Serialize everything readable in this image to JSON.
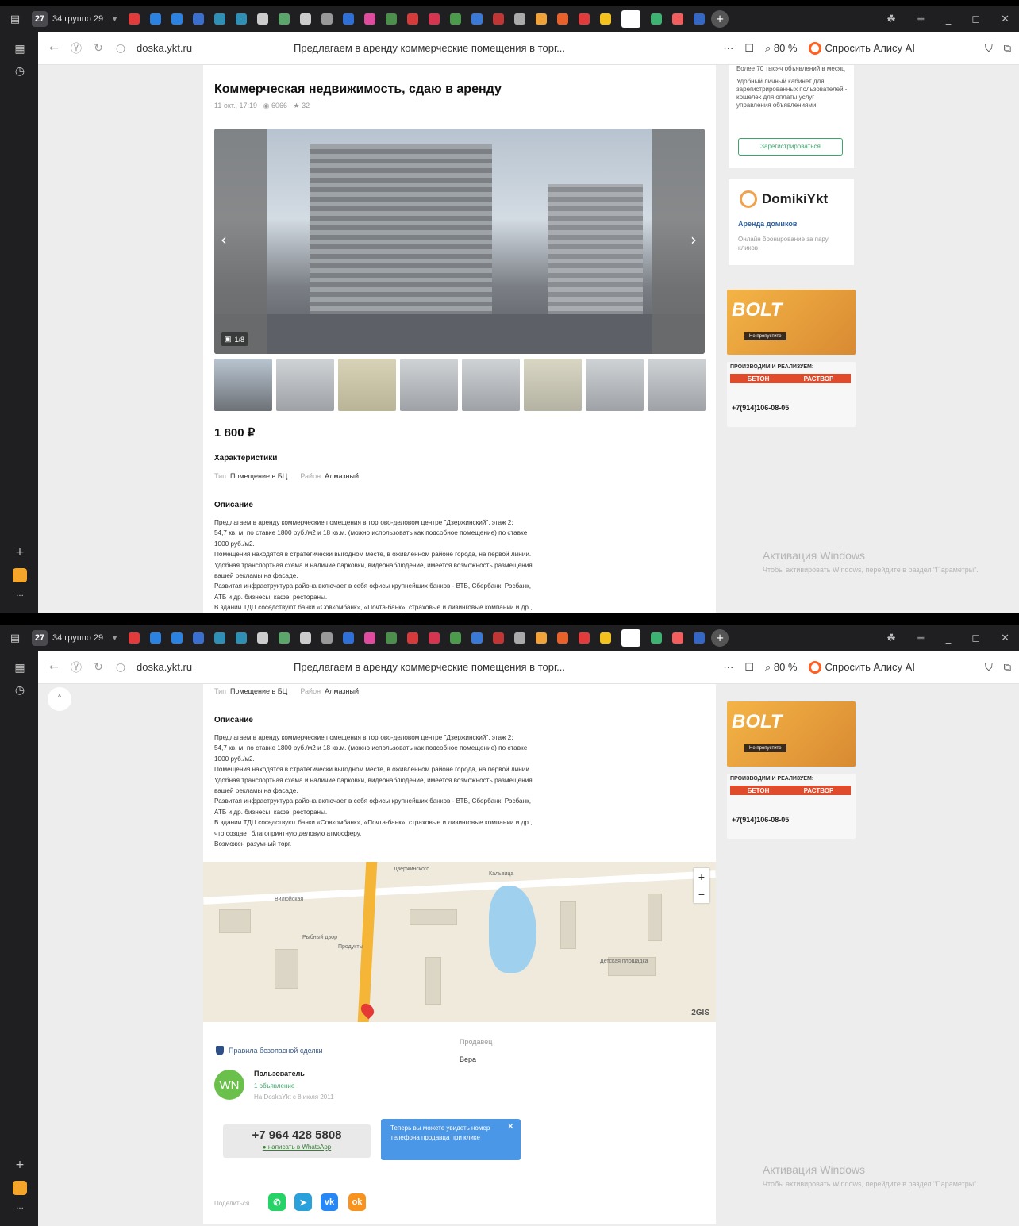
{
  "browser": {
    "tab_count": "27",
    "group_label": "34 группо 29",
    "domain": "doska.ykt.ru",
    "page_title": "Предлагаем в аренду коммерческие помещения в торг...",
    "zoom": "80 %",
    "alice_label": "Спросить Алису AI",
    "ellipsis": "···"
  },
  "listing": {
    "title": "Коммерческая недвижимость, сдаю в аренду",
    "date": "11 окт., 17:19",
    "views": "6066",
    "favorites": "32",
    "photo_counter": "1/8",
    "price": "1 800 ₽",
    "chars_heading": "Характеристики",
    "type_key": "Тип",
    "type_val": "Помещение в БЦ",
    "district_key": "Район",
    "district_val": "Алмазный",
    "desc_heading": "Описание",
    "description": [
      "Предлагаем в аренду коммерческие помещения в торгово-деловом центре \"Дзержинский\", этаж 2:",
      "54,7 кв. м. по ставке 1800 руб./м2 и 18 кв.м. (можно использовать как подсобное помещение) по ставке",
      "1000 руб./м2.",
      "Помещения находятся в стратегически выгодном месте, в оживленном районе города, на первой линии.",
      "Удобная транспортная схема и наличие парковки, видеонаблюдение, имеется возможность размещения",
      "вашей рекламы на фасаде.",
      "Развитая инфраструктура района включает в себя офисы крупнейших банков - ВТБ, Сбербанк, Росбанк,",
      "АТБ и др. бизнесы, кафе, рестораны.",
      "В здании ТДЦ соседствуют банки «Совкомбанк», «Почта-банк», страховые и лизинговые компании и др.,",
      "что создает благоприятную деловую атмосферу.",
      "Возможен разумный торг."
    ],
    "safe_deal": "Правила безопасной сделки",
    "seller_label": "Продавец",
    "seller_name": "Вера",
    "user_initials": "WN",
    "user_title": "Пользователь",
    "user_ads": "1 объявление",
    "user_since": "На DoskaYkt с 8 июля 2011",
    "phone": "+7 964 428 5808",
    "whatsapp": "написать в WhatsApp",
    "tooltip": "Теперь вы можете увидеть номер телефона продавца при клике",
    "share_label": "Поделиться",
    "map_logo": "2GIS",
    "map_labels": [
      "Кальвица",
      "Дзержинского",
      "Вилюйская",
      "Рыбный двор",
      "Продукты",
      "Детская площадка"
    ]
  },
  "sidebar": {
    "bullet1": "Более 70 тысяч объявлений в месяц",
    "bullet2": "Удобный личный кабинет для зарегистрированных пользователей - кошелек для оплаты услуг управления объявлениями.",
    "register": "Зарегистрироваться",
    "domiki_name": "DomikiYkt",
    "domiki_title": "Аренда домиков",
    "domiki_sub": "Онлайн бронирование за пару кликов",
    "ad1_brand": "BOLT",
    "ad1_cta": "Не пропустите",
    "ad2_top": "ПРОИЗВОДИМ И РЕАЛИЗУЕМ:",
    "ad2_a": "БЕТОН",
    "ad2_b": "РАСТВОР",
    "ad2_phone": "+7(914)106-08-05"
  },
  "watermark": {
    "title": "Активация Windows",
    "sub": "Чтобы активировать Windows, перейдите в раздел \"Параметры\"."
  },
  "colors": {
    "accent_green": "#3ca56a",
    "tooltip_blue": "#4a97e8",
    "alice_orange": "#ff5f1f",
    "whatsapp": "#25d366",
    "telegram": "#2aa1da",
    "vk": "#2787f5",
    "ok": "#f7931e"
  }
}
